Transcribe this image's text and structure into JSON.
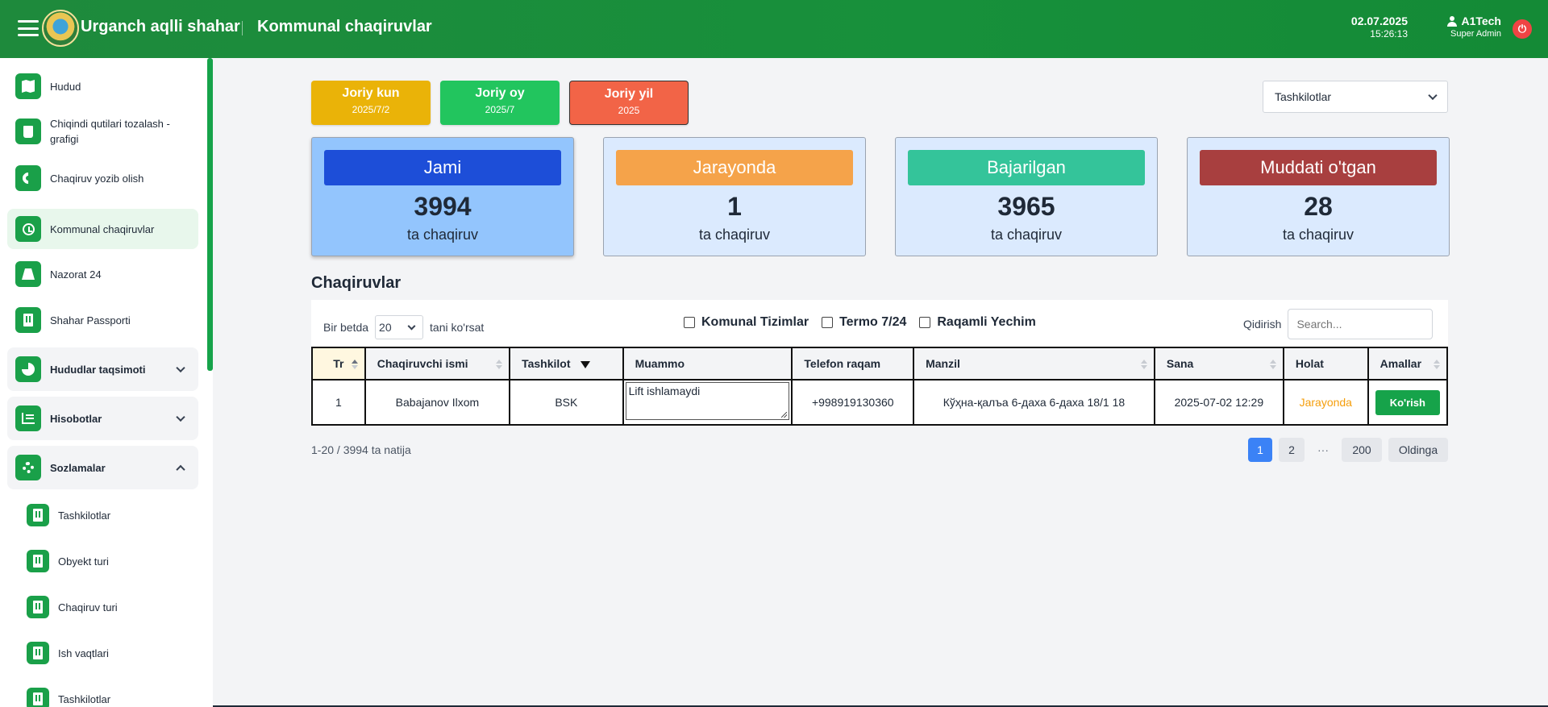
{
  "header": {
    "app_title": "Urganch aqlli shahar",
    "page_title": "Kommunal chaqiruvlar",
    "date": "02.07.2025",
    "time": "15:26:13",
    "user_name": "A1Tech",
    "user_role": "Super Admin"
  },
  "sidebar": {
    "items": [
      {
        "label": "Hudud",
        "icon": "map-icon"
      },
      {
        "label": "Chiqindi qutilari tozalash - grafigi",
        "icon": "trash-icon"
      },
      {
        "label": "Chaqiruv yozib olish",
        "icon": "phone-icon"
      },
      {
        "label": "Kommunal chaqiruvlar",
        "icon": "history-icon",
        "active": true
      },
      {
        "label": "Nazorat 24",
        "icon": "road-icon"
      },
      {
        "label": "Shahar Passporti",
        "icon": "building-icon"
      },
      {
        "label": "Hududlar taqsimoti",
        "icon": "pie-chart-icon"
      },
      {
        "label": "Hisobotlar",
        "icon": "bar-chart-icon"
      },
      {
        "label": "Sozlamalar",
        "icon": "gears-icon"
      },
      {
        "label": "Tashkilotlar",
        "icon": "building-icon"
      },
      {
        "label": "Obyekt turi",
        "icon": "building-icon"
      },
      {
        "label": "Chaqiruv turi",
        "icon": "building-icon"
      },
      {
        "label": "Ish vaqtlari",
        "icon": "building-icon"
      },
      {
        "label": "Tashkilotlar",
        "icon": "building-icon"
      }
    ]
  },
  "periods": {
    "day": {
      "title": "Joriy kun",
      "value": "2025/7/2"
    },
    "month": {
      "title": "Joriy oy",
      "value": "2025/7"
    },
    "year": {
      "title": "Joriy yil",
      "value": "2025"
    }
  },
  "org_select": {
    "value": "Tashkilotlar"
  },
  "stats": [
    {
      "label": "Jami",
      "count": "3994",
      "unit": "ta chaqiruv"
    },
    {
      "label": "Jarayonda",
      "count": "1",
      "unit": "ta chaqiruv"
    },
    {
      "label": "Bajarilgan",
      "count": "3965",
      "unit": "ta chaqiruv"
    },
    {
      "label": "Muddati o'tgan",
      "count": "28",
      "unit": "ta chaqiruv"
    }
  ],
  "section_title": "Chaqiruvlar",
  "table_controls": {
    "per_page_prefix": "Bir betda",
    "per_page_value": "20",
    "per_page_suffix": "tani ko'rsat",
    "filters": [
      "Komunal Tizimlar",
      "Termo 7/24",
      "Raqamli Yechim"
    ],
    "search_label": "Qidirish",
    "search_placeholder": "Search..."
  },
  "table": {
    "columns": [
      "Tr",
      "Chaqiruvchi ismi",
      "Tashkilot",
      "Muammo",
      "Telefon raqam",
      "Manzil",
      "Sana",
      "Holat",
      "Amallar"
    ],
    "rows": [
      {
        "tr": "1",
        "caller": "Babajanov Ilxom",
        "org": "BSK",
        "problem": "Lift ishlamaydi",
        "phone": "+998919130360",
        "address": "Кўҳна-қалъа 6-даха 6-даха 18/1 18",
        "date": "2025-07-02 12:29",
        "status": "Jarayonda",
        "action": "Ko'rish"
      }
    ]
  },
  "pagination": {
    "summary": "1-20 / 3994 ta natija",
    "pages": [
      "1",
      "2",
      "···",
      "200"
    ],
    "next": "Oldinga"
  },
  "colors": {
    "header_green": "#1e8a3c",
    "accent_green": "#16a34a",
    "total_blue": "#1d4ed8",
    "in_progress_orange": "#f5a34a",
    "done_teal": "#34c49a",
    "overdue_red": "#a83f3f",
    "status_orange": "#f59e0b"
  }
}
